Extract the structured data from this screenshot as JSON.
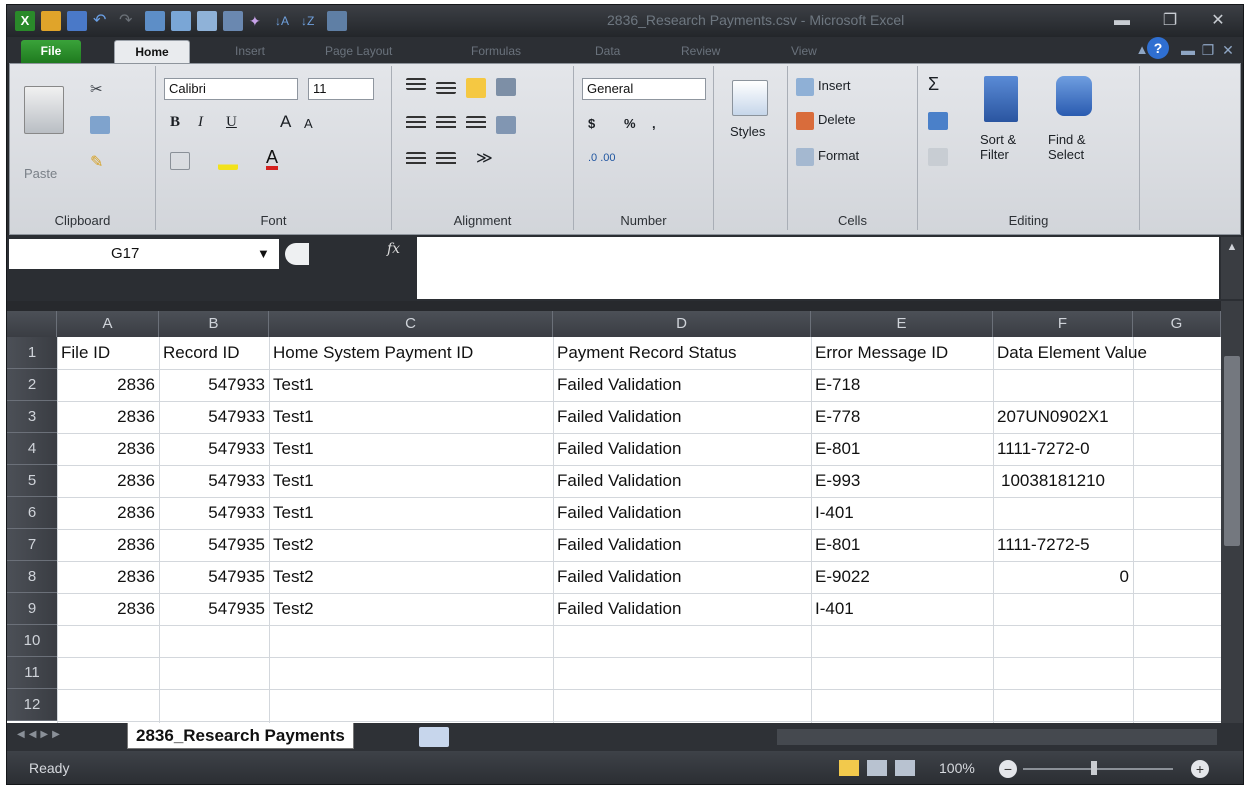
{
  "window": {
    "title": "2836_Research Payments.csv - Microsoft Excel",
    "minimize_glyph": "▬",
    "restore_glyph": "❐",
    "close_glyph": "✕"
  },
  "ribbon_tabs": [
    "File",
    "Home",
    "Insert",
    "Page Layout",
    "Formulas",
    "Data",
    "Review",
    "View"
  ],
  "ribbon": {
    "clipboard": {
      "label": "Clipboard",
      "paste": "Paste"
    },
    "font": {
      "label": "Font",
      "name": "Calibri",
      "size": "11"
    },
    "alignment": {
      "label": "Alignment"
    },
    "number": {
      "label": "Number",
      "format": "General",
      "currency": "$",
      "percent": "%",
      "comma": ","
    },
    "styles": {
      "label": "Styles"
    },
    "cells": {
      "label": "Cells",
      "insert": "Insert",
      "delete": "Delete",
      "format": "Format"
    },
    "editing": {
      "label": "Editing",
      "sort_filter": "Sort & Filter",
      "find_select": "Find & Select",
      "sum_glyph": "Σ"
    }
  },
  "formula_bar": {
    "name_box": "G17",
    "fx": "fx",
    "value": ""
  },
  "columns": [
    "A",
    "B",
    "C",
    "D",
    "E",
    "F",
    "G"
  ],
  "rows": [
    [
      "File ID",
      "Record ID",
      "Home System Payment ID",
      "Payment Record Status",
      "Error Message ID",
      "Data Element Value",
      ""
    ],
    [
      "2836",
      "547933",
      "Test1",
      "Failed Validation",
      "E-718",
      "",
      ""
    ],
    [
      "2836",
      "547933",
      "Test1",
      "Failed Validation",
      "E-778",
      "207UN0902X1",
      ""
    ],
    [
      "2836",
      "547933",
      "Test1",
      "Failed Validation",
      "E-801",
      "1111-7272-0",
      ""
    ],
    [
      "2836",
      "547933",
      "Test1",
      "Failed Validation",
      "E-993",
      "10038181210",
      ""
    ],
    [
      "2836",
      "547933",
      "Test1",
      "Failed Validation",
      "I-401",
      "",
      ""
    ],
    [
      "2836",
      "547935",
      "Test2",
      "Failed Validation",
      "E-801",
      "1111-7272-5",
      ""
    ],
    [
      "2836",
      "547935",
      "Test2",
      "Failed Validation",
      "E-9022",
      "0",
      ""
    ],
    [
      "2836",
      "547935",
      "Test2",
      "Failed Validation",
      "I-401",
      "",
      ""
    ],
    [
      "",
      "",
      "",
      "",
      "",
      "",
      ""
    ],
    [
      "",
      "",
      "",
      "",
      "",
      "",
      ""
    ],
    [
      "",
      "",
      "",
      "",
      "",
      "",
      ""
    ]
  ],
  "row_numbers": [
    "1",
    "2",
    "3",
    "4",
    "5",
    "6",
    "7",
    "8",
    "9",
    "10",
    "11",
    "12"
  ],
  "sheet_tab": "2836_Research Payments",
  "status": {
    "ready": "Ready",
    "zoom": "100%"
  },
  "colors": {
    "file_tab": "#2d8f2d",
    "grid_line": "#d3d7dc",
    "header_bg": "#44484e"
  }
}
